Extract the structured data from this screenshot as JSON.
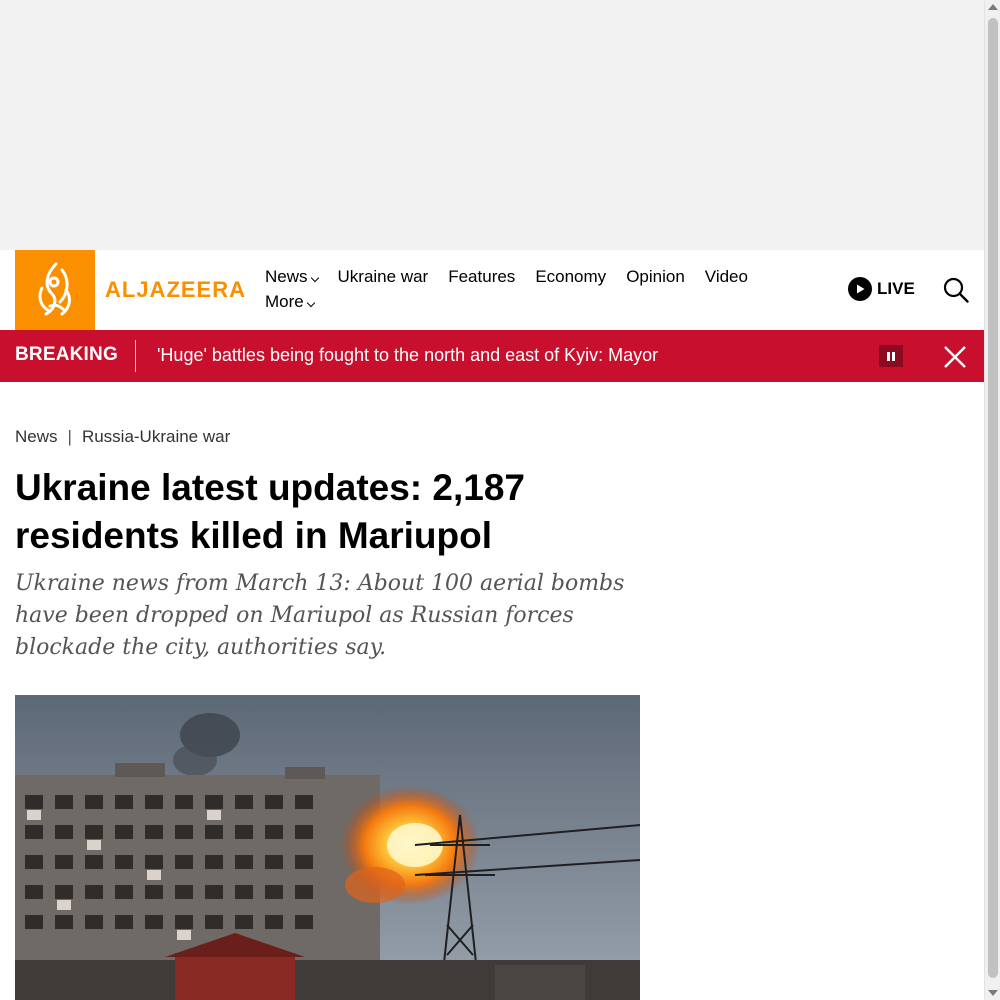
{
  "brand": {
    "name": "ALJAZEERA",
    "accent": "#fa9000"
  },
  "nav": {
    "items": [
      {
        "label": "News",
        "has_dropdown": true
      },
      {
        "label": "Ukraine war",
        "has_dropdown": false
      },
      {
        "label": "Features",
        "has_dropdown": false
      },
      {
        "label": "Economy",
        "has_dropdown": false
      },
      {
        "label": "Opinion",
        "has_dropdown": false
      },
      {
        "label": "Video",
        "has_dropdown": false
      },
      {
        "label": "More",
        "has_dropdown": true
      }
    ],
    "live_label": "LIVE"
  },
  "breaking": {
    "label": "BREAKING",
    "headline": "'Huge' battles being fought to the north and east of Kyiv: Mayor",
    "color": "#c8102e"
  },
  "article": {
    "breadcrumb": [
      "News",
      "Russia-Ukraine war"
    ],
    "breadcrumb_separator": "|",
    "title": "Ukraine latest updates: 2,187 residents killed in Mariupol",
    "subtitle": "Ukraine news from March 13: About 100 aerial bombs have been dropped on Mariupol as Russian forces blockade the city, authorities say."
  }
}
